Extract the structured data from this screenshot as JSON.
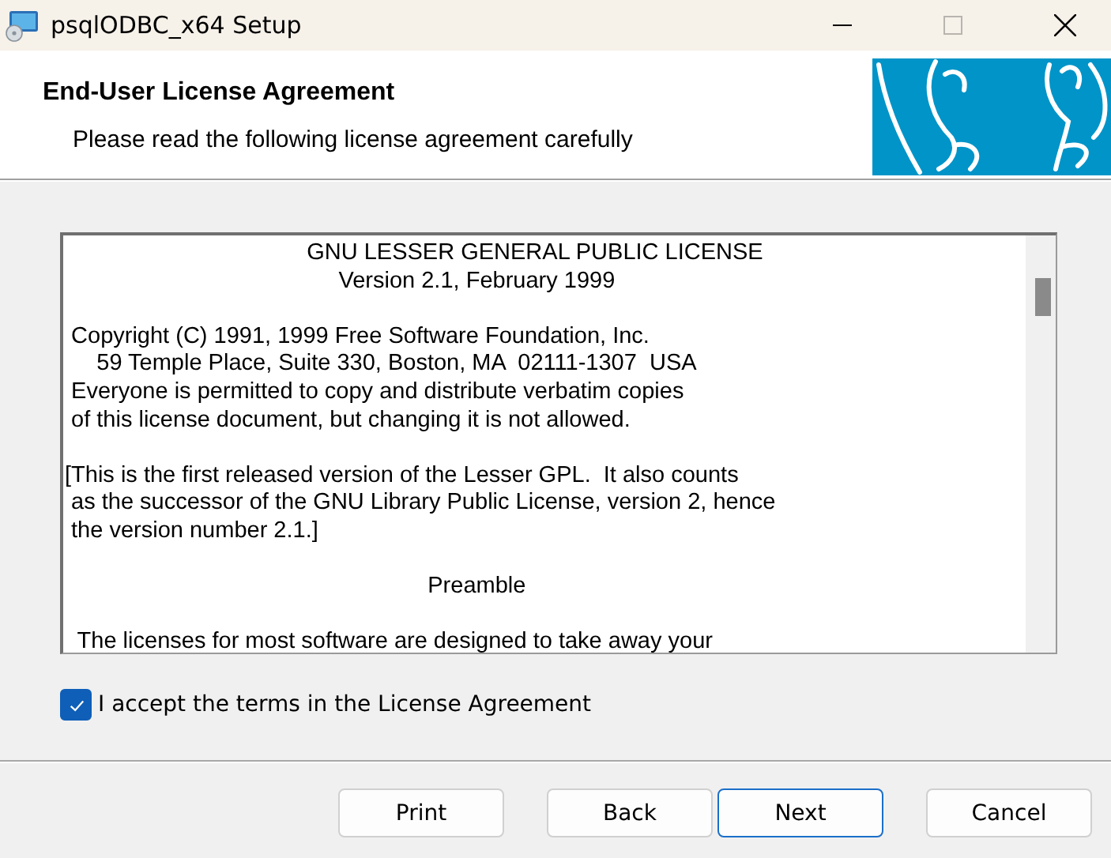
{
  "window": {
    "title": "psqlODBC_x64 Setup"
  },
  "header": {
    "title": "End-User License Agreement",
    "subtitle": "Please read the following license agreement carefully"
  },
  "license_text": [
    "                                      GNU LESSER GENERAL PUBLIC LICENSE\n                                           Version 2.1, February 1999",
    " Copyright (C) 1991, 1999 Free Software Foundation, Inc.\n     59 Temple Place, Suite 330, Boston, MA  02111-1307  USA\n Everyone is permitted to copy and distribute verbatim copies\n of this license document, but changing it is not allowed.",
    "[This is the first released version of the Lesser GPL.  It also counts\n as the successor of the GNU Library Public License, version 2, hence\n the version number 2.1.]",
    "                                                         Preamble",
    "  The licenses for most software are designed to take away your"
  ],
  "accept": {
    "label": "I accept the terms in the License Agreement",
    "checked": true
  },
  "buttons": [
    {
      "label": "Print",
      "default": false
    },
    {
      "label": "Back",
      "default": false
    },
    {
      "label": "Next",
      "default": true
    },
    {
      "label": "Cancel",
      "default": false
    }
  ]
}
